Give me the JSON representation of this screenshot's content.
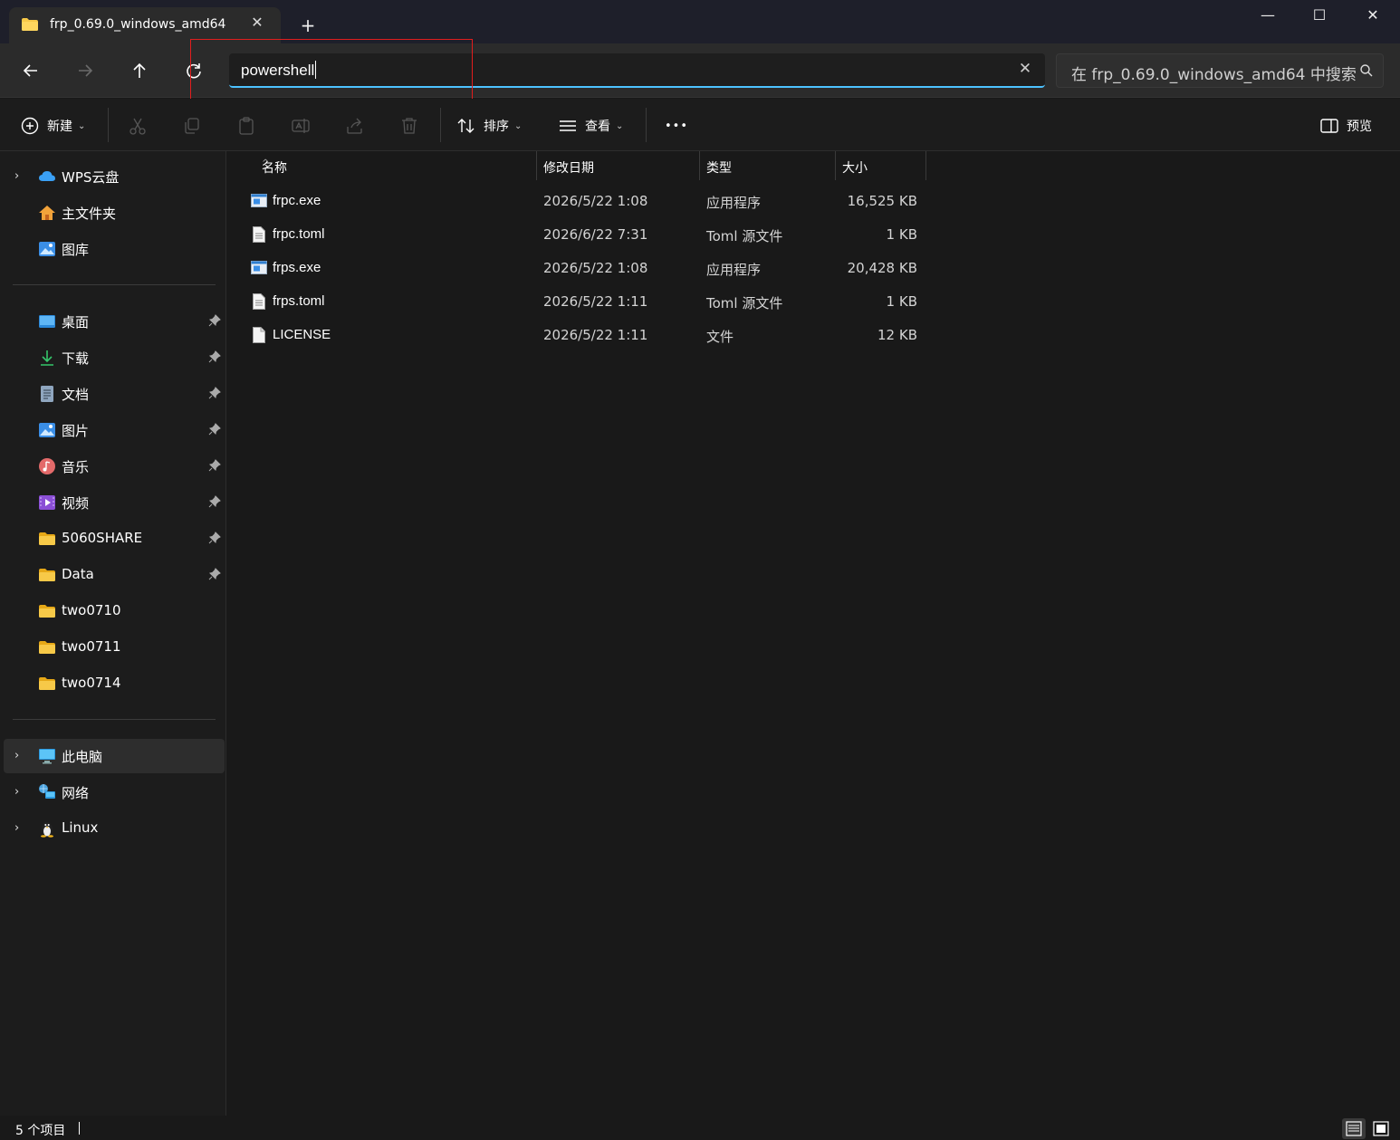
{
  "window": {
    "tab_title": "frp_0.69.0_windows_amd64",
    "tab_close": "✕",
    "new_tab": "+",
    "minimize": "—",
    "maximize": "☐",
    "close": "✕"
  },
  "address": {
    "value": "powershell",
    "clear": "✕"
  },
  "search": {
    "placeholder": "在 frp_0.69.0_windows_amd64 中搜索"
  },
  "commands": {
    "new_label": "新建",
    "sort_label": "排序",
    "view_label": "查看",
    "more_label": "•••",
    "preview_label": "预览"
  },
  "sidebar": {
    "top": [
      {
        "label": "WPS云盘",
        "icon": "cloud-icon",
        "expandable": true
      },
      {
        "label": "主文件夹",
        "icon": "home-icon",
        "expandable": false
      },
      {
        "label": "图库",
        "icon": "gallery-icon",
        "expandable": false
      }
    ],
    "quick": [
      {
        "label": "桌面",
        "icon": "desktop-icon",
        "pinned": true
      },
      {
        "label": "下载",
        "icon": "download-icon",
        "pinned": true
      },
      {
        "label": "文档",
        "icon": "document-icon",
        "pinned": true
      },
      {
        "label": "图片",
        "icon": "pictures-icon",
        "pinned": true
      },
      {
        "label": "音乐",
        "icon": "music-icon",
        "pinned": true
      },
      {
        "label": "视频",
        "icon": "video-icon",
        "pinned": true
      },
      {
        "label": "5060SHARE",
        "icon": "folder-icon",
        "pinned": true
      },
      {
        "label": "Data",
        "icon": "folder-icon",
        "pinned": true
      },
      {
        "label": "two0710",
        "icon": "folder-icon",
        "pinned": false
      },
      {
        "label": "two0711",
        "icon": "folder-icon",
        "pinned": false
      },
      {
        "label": "two0714",
        "icon": "folder-icon",
        "pinned": false
      }
    ],
    "devices": [
      {
        "label": "此电脑",
        "icon": "computer-icon",
        "selected": true
      },
      {
        "label": "网络",
        "icon": "network-icon",
        "selected": false
      },
      {
        "label": "Linux",
        "icon": "linux-icon",
        "selected": false
      }
    ]
  },
  "columns": {
    "name": "名称",
    "modified": "修改日期",
    "type": "类型",
    "size": "大小"
  },
  "files": [
    {
      "name": "frpc.exe",
      "modified": "2026/5/22 1:08",
      "type": "应用程序",
      "size": "16,525 KB",
      "icon": "exe-icon"
    },
    {
      "name": "frpc.toml",
      "modified": "2026/6/22 7:31",
      "type": "Toml 源文件",
      "size": "1 KB",
      "icon": "text-file-icon"
    },
    {
      "name": "frps.exe",
      "modified": "2026/5/22 1:08",
      "type": "应用程序",
      "size": "20,428 KB",
      "icon": "exe-icon"
    },
    {
      "name": "frps.toml",
      "modified": "2026/5/22 1:11",
      "type": "Toml 源文件",
      "size": "1 KB",
      "icon": "text-file-icon"
    },
    {
      "name": "LICENSE",
      "modified": "2026/5/22 1:11",
      "type": "文件",
      "size": "12 KB",
      "icon": "blank-file-icon"
    }
  ],
  "status": {
    "item_count": "5 个项目"
  },
  "colors": {
    "accent": "#4cc2ff",
    "annotation": "#e21d1d",
    "folder": "#f7c948"
  }
}
